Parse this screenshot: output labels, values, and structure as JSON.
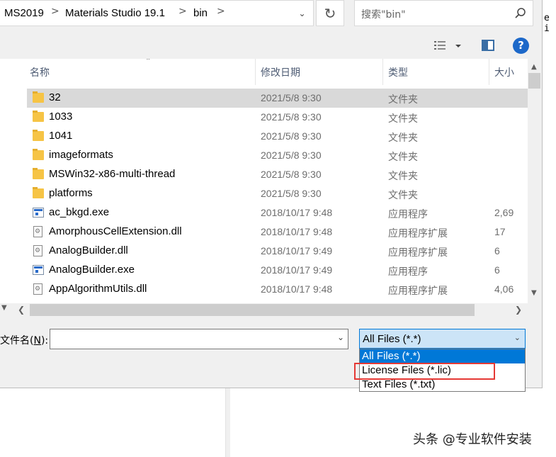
{
  "address": {
    "segments": [
      "MS2019",
      "Materials Studio 19.1",
      "bin"
    ],
    "separator": ">",
    "dropdown_icon": "chevron-down-icon"
  },
  "search": {
    "placeholder": "搜索\"bin\"",
    "icon": "search-icon"
  },
  "background_code": "e i",
  "columns": {
    "name": "名称",
    "date": "修改日期",
    "type": "类型",
    "size": "大小"
  },
  "files": [
    {
      "name": "32",
      "date": "2021/5/8 9:30",
      "type": "文件夹",
      "size": "",
      "icon": "folder-icon",
      "selected": true
    },
    {
      "name": "1033",
      "date": "2021/5/8 9:30",
      "type": "文件夹",
      "size": "",
      "icon": "folder-icon"
    },
    {
      "name": "1041",
      "date": "2021/5/8 9:30",
      "type": "文件夹",
      "size": "",
      "icon": "folder-icon"
    },
    {
      "name": "imageformats",
      "date": "2021/5/8 9:30",
      "type": "文件夹",
      "size": "",
      "icon": "folder-icon"
    },
    {
      "name": "MSWin32-x86-multi-thread",
      "date": "2021/5/8 9:30",
      "type": "文件夹",
      "size": "",
      "icon": "folder-icon"
    },
    {
      "name": "platforms",
      "date": "2021/5/8 9:30",
      "type": "文件夹",
      "size": "",
      "icon": "folder-icon"
    },
    {
      "name": "ac_bkgd.exe",
      "date": "2018/10/17 9:48",
      "type": "应用程序",
      "size": "2,69",
      "icon": "exe-icon"
    },
    {
      "name": "AmorphousCellExtension.dll",
      "date": "2018/10/17 9:48",
      "type": "应用程序扩展",
      "size": "17",
      "icon": "dll-icon"
    },
    {
      "name": "AnalogBuilder.dll",
      "date": "2018/10/17 9:49",
      "type": "应用程序扩展",
      "size": "6",
      "icon": "dll-icon"
    },
    {
      "name": "AnalogBuilder.exe",
      "date": "2018/10/17 9:49",
      "type": "应用程序",
      "size": "6",
      "icon": "exe-icon"
    },
    {
      "name": "AppAlgorithmUtils.dll",
      "date": "2018/10/17 9:48",
      "type": "应用程序扩展",
      "size": "4,06",
      "icon": "dll-icon"
    }
  ],
  "filename": {
    "label": "文件名(",
    "mnemonic": "N",
    "label_end": "):",
    "value": ""
  },
  "filter": {
    "selected": "All Files (*.*)",
    "options": [
      "All Files (*.*)",
      "License Files (*.lic)",
      "Text Files (*.txt)"
    ],
    "highlighted_index": 0,
    "annotated_index": 1,
    "annotation_color": "#e53935"
  },
  "watermark": "头条 @专业软件安装",
  "colors": {
    "accent": "#0078d7",
    "selection": "#d9d9d9",
    "help": "#1c68c9",
    "folder": "#f6c445"
  }
}
